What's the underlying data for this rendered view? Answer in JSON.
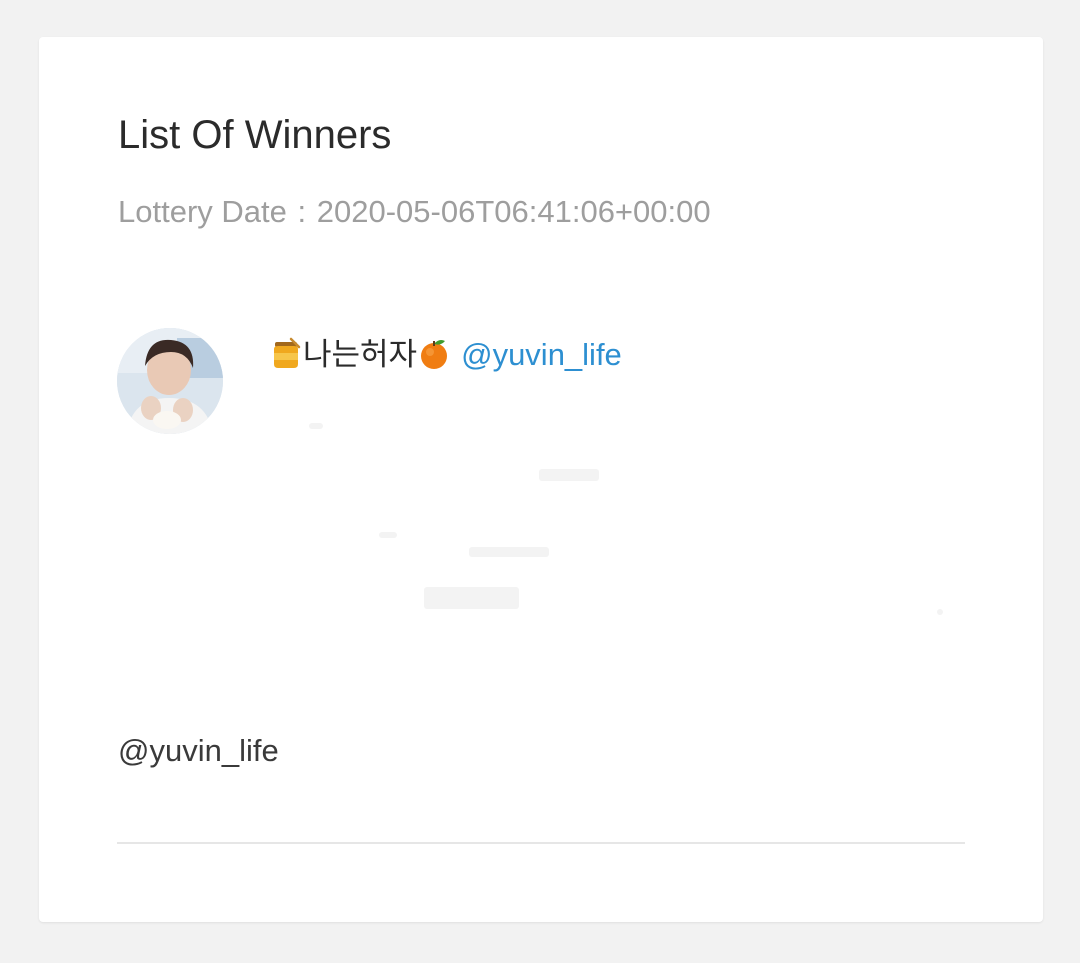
{
  "card": {
    "title": "List Of Winners",
    "lottery_date_label": "Lottery Date",
    "lottery_date_separator": ":",
    "lottery_date_value": "2020-05-06T06:41:06+00:00"
  },
  "winner": {
    "avatar_icon": "user-avatar-photo",
    "leading_icon": "honey-pot-icon",
    "display_name": "나는허자",
    "trailing_icon": "tangerine-icon",
    "handle": "@yuvin_life",
    "handle_color": "#2d8fd1"
  },
  "footer": {
    "handle": "@yuvin_life"
  },
  "colors": {
    "page_background": "#f2f2f2",
    "card_background": "#ffffff",
    "title_text": "#2b2b2b",
    "muted_text": "#9e9e9e",
    "divider": "#e6e6e6"
  }
}
